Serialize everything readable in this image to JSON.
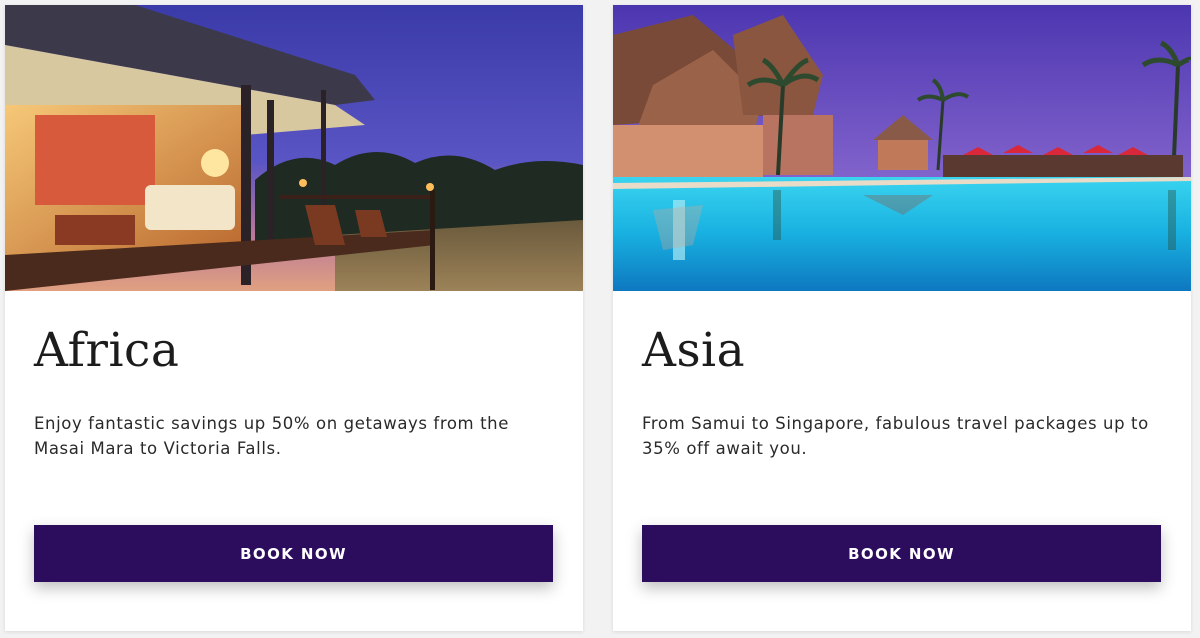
{
  "cards": [
    {
      "title": "Africa",
      "description": "Enjoy fantastic savings up 50% on getaways from the Masai Mara to Victoria Falls.",
      "button_label": "BOOK NOW"
    },
    {
      "title": "Asia",
      "description": "From Samui to Singapore, fabulous travel packages up to 35% off await you.",
      "button_label": "BOOK NOW"
    }
  ],
  "colors": {
    "button_bg": "#2c0c5c",
    "button_text": "#ffffff",
    "card_bg": "#ffffff",
    "page_bg": "#f2f2f2"
  }
}
